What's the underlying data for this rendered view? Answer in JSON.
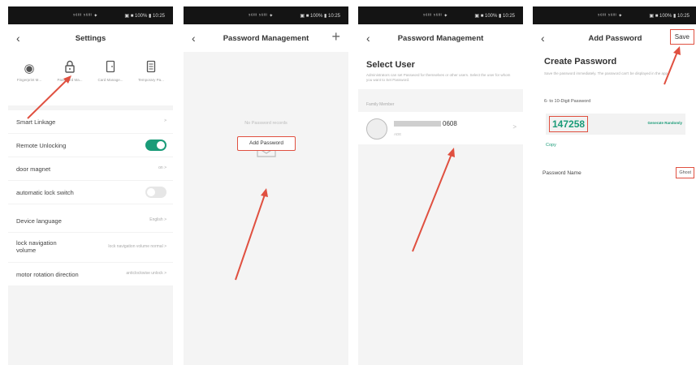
{
  "colors": {
    "accent": "#1a9b78",
    "highlight": "#e05040",
    "statusbar": "#141414"
  },
  "statusbar": {
    "left": "⁵⁶ᴵᴵᴵ ⁵⁶ᴵᴵᴵ ✦",
    "right": "▣ ■ 100% ▮ 10:25"
  },
  "screen1": {
    "title": "Settings",
    "icons": [
      {
        "icon": "fingerprint-icon",
        "glyph": "◉",
        "label": "Fingerprint M..."
      },
      {
        "icon": "lock-icon",
        "glyph": "🔒",
        "label": "Password Ma..."
      },
      {
        "icon": "card-icon",
        "glyph": "▯",
        "label": "Card Manage..."
      },
      {
        "icon": "temporary-password-icon",
        "glyph": "▤",
        "label": "Temporary Pa..."
      }
    ],
    "rows": [
      {
        "label": "Smart Linkage",
        "value": ">"
      },
      {
        "label": "Remote Unlocking",
        "toggle": "on"
      },
      {
        "label": "door magnet",
        "value": "on >"
      },
      {
        "label": "automatic lock switch",
        "toggle": "off"
      },
      {
        "label": "Device language",
        "value": "English >"
      },
      {
        "label": "lock navigation volume",
        "value": "lock navigation volume normal >"
      },
      {
        "label": "motor rotation direction",
        "value": "anticlockwise unlock >"
      }
    ]
  },
  "screen2": {
    "title": "Password Management",
    "plus": "+",
    "empty_text": "No Password records",
    "add_button": "Add Password"
  },
  "screen3": {
    "title": "Password Management",
    "heading": "Select User",
    "description": "Administrators can set Password for themselves or other users. Select the user for whom you want to Set Password.",
    "group_label": "Family Member",
    "user_name_suffix": "0608",
    "user_sub": "ADE",
    "chevron": ">"
  },
  "screen4": {
    "title": "Add Password",
    "save": "Save",
    "heading": "Create Password",
    "description": "Save the password immediately. The password can't be displayed in the app.",
    "sublabel": "6- to 10-Digit Password",
    "password": "147258",
    "generate": "Generate Randomly",
    "copy": "Copy",
    "name_label": "Password Name",
    "name_value": "Ghost"
  }
}
